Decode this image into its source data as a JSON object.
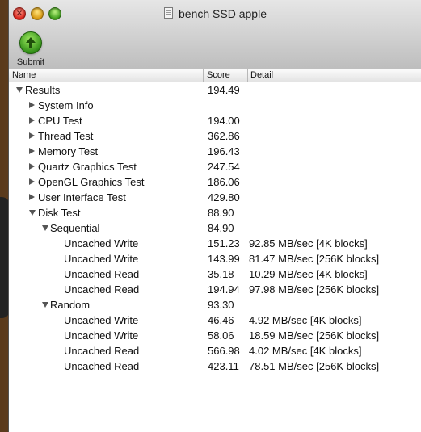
{
  "window": {
    "title": "bench SSD apple"
  },
  "toolbar": {
    "submit_label": "Submit"
  },
  "table": {
    "columns": [
      "Name",
      "Score",
      "Detail"
    ],
    "rows": [
      {
        "name": "Results",
        "score": "194.49",
        "detail": "",
        "level": 0,
        "disclosure": "expanded"
      },
      {
        "name": "System Info",
        "score": "",
        "detail": "",
        "level": 1,
        "disclosure": "collapsed"
      },
      {
        "name": "CPU Test",
        "score": "194.00",
        "detail": "",
        "level": 1,
        "disclosure": "collapsed"
      },
      {
        "name": "Thread Test",
        "score": "362.86",
        "detail": "",
        "level": 1,
        "disclosure": "collapsed"
      },
      {
        "name": "Memory Test",
        "score": "196.43",
        "detail": "",
        "level": 1,
        "disclosure": "collapsed"
      },
      {
        "name": "Quartz Graphics Test",
        "score": "247.54",
        "detail": "",
        "level": 1,
        "disclosure": "collapsed"
      },
      {
        "name": "OpenGL Graphics Test",
        "score": "186.06",
        "detail": "",
        "level": 1,
        "disclosure": "collapsed"
      },
      {
        "name": "User Interface Test",
        "score": "429.80",
        "detail": "",
        "level": 1,
        "disclosure": "collapsed"
      },
      {
        "name": "Disk Test",
        "score": "88.90",
        "detail": "",
        "level": 1,
        "disclosure": "expanded"
      },
      {
        "name": "Sequential",
        "score": "84.90",
        "detail": "",
        "level": 2,
        "disclosure": "expanded"
      },
      {
        "name": "Uncached Write",
        "score": "151.23",
        "detail": "92.85 MB/sec [4K blocks]",
        "level": 3,
        "disclosure": "none"
      },
      {
        "name": "Uncached Write",
        "score": "143.99",
        "detail": "81.47 MB/sec [256K blocks]",
        "level": 3,
        "disclosure": "none"
      },
      {
        "name": "Uncached Read",
        "score": "35.18",
        "detail": "10.29 MB/sec [4K blocks]",
        "level": 3,
        "disclosure": "none"
      },
      {
        "name": "Uncached Read",
        "score": "194.94",
        "detail": "97.98 MB/sec [256K blocks]",
        "level": 3,
        "disclosure": "none"
      },
      {
        "name": "Random",
        "score": "93.30",
        "detail": "",
        "level": 2,
        "disclosure": "expanded"
      },
      {
        "name": "Uncached Write",
        "score": "46.46",
        "detail": "4.92 MB/sec [4K blocks]",
        "level": 3,
        "disclosure": "none"
      },
      {
        "name": "Uncached Write",
        "score": "58.06",
        "detail": "18.59 MB/sec [256K blocks]",
        "level": 3,
        "disclosure": "none"
      },
      {
        "name": "Uncached Read",
        "score": "566.98",
        "detail": "4.02 MB/sec [4K blocks]",
        "level": 3,
        "disclosure": "none"
      },
      {
        "name": "Uncached Read",
        "score": "423.11",
        "detail": "78.51 MB/sec [256K blocks]",
        "level": 3,
        "disclosure": "none"
      }
    ]
  },
  "colors": {
    "close": "#d8231a",
    "minimize": "#d99a12",
    "zoom": "#3f9f1c",
    "submit": "#2c8a14"
  }
}
